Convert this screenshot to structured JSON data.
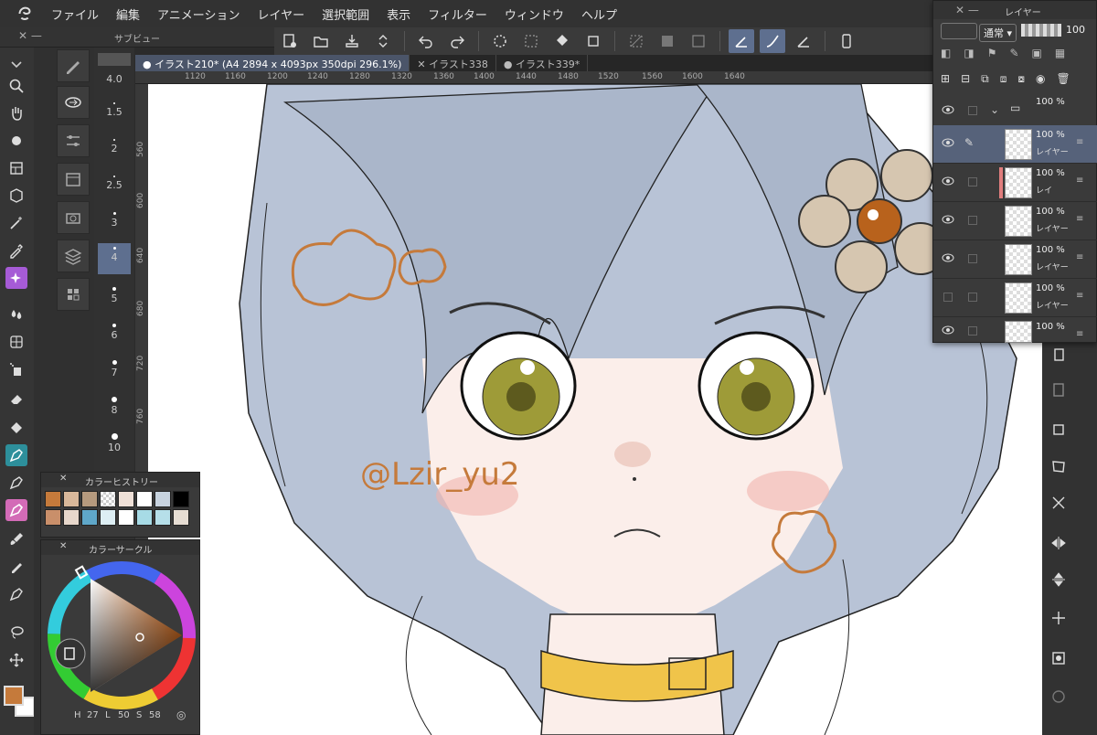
{
  "menu": [
    "ファイル",
    "編集",
    "アニメーション",
    "レイヤー",
    "選択範囲",
    "表示",
    "フィルター",
    "ウィンドウ",
    "ヘルプ"
  ],
  "subview": {
    "title": "サブビュー"
  },
  "tabs": [
    {
      "label": "イラスト210* (A4 2894 x 4093px 350dpi 296.1%)",
      "active": true
    },
    {
      "label": "イラスト338",
      "active": false
    },
    {
      "label": "イラスト339*",
      "active": false
    }
  ],
  "ruler": {
    "h": [
      "1120",
      "1160",
      "1200",
      "1240",
      "1280",
      "1320",
      "1360",
      "1400",
      "1440",
      "1480",
      "1520",
      "1560",
      "1600",
      "1640"
    ],
    "v": [
      "560",
      "600",
      "640",
      "680",
      "720",
      "760"
    ]
  },
  "brush_size": {
    "current": "4.0",
    "sizes": [
      "1.5",
      "2",
      "2.5",
      "3",
      "4",
      "5",
      "6",
      "7",
      "8",
      "10"
    ],
    "selected": "4"
  },
  "layer_panel": {
    "title": "レイヤー",
    "blend_mode": "通常",
    "opacity": "100",
    "layers": [
      {
        "opacity": "100 %",
        "name": "",
        "type": "folder",
        "visible": true
      },
      {
        "opacity": "100 %",
        "name": "レイヤー",
        "type": "layer",
        "visible": true,
        "selected": true
      },
      {
        "opacity": "100 %",
        "name": "レイ",
        "type": "layer",
        "visible": true
      },
      {
        "opacity": "100 %",
        "name": "レイヤー",
        "type": "layer",
        "visible": true
      },
      {
        "opacity": "100 %",
        "name": "レイヤー",
        "type": "layer",
        "visible": true
      },
      {
        "opacity": "100 %",
        "name": "レイヤー",
        "type": "layer",
        "visible": false
      },
      {
        "opacity": "100 %",
        "name": "",
        "type": "layer",
        "visible": true
      }
    ]
  },
  "color_history": {
    "title": "カラーヒストリー",
    "swatches": [
      "#c57a3b",
      "#d9b89a",
      "#b69a7e",
      "checker",
      "#eedfd6",
      "#ffffff",
      "#c7d2de",
      "#000000",
      "#c98f6a",
      "#e7d7cb",
      "#5fa7c9",
      "#ddeef4",
      "#ffffff",
      "#a7dbe6",
      "#b6dfe9",
      "#e6ddd3"
    ]
  },
  "color_circle": {
    "title": "カラーサークル",
    "h_label": "H",
    "h": "27",
    "l_label": "L",
    "l": "50",
    "s_label": "S",
    "s": "58"
  },
  "colors": {
    "main": "#c57a3b",
    "sub": "#ffffff",
    "selection": "#5e6f8f"
  },
  "canvas": {
    "watermark": "@Lzir_yu2"
  }
}
